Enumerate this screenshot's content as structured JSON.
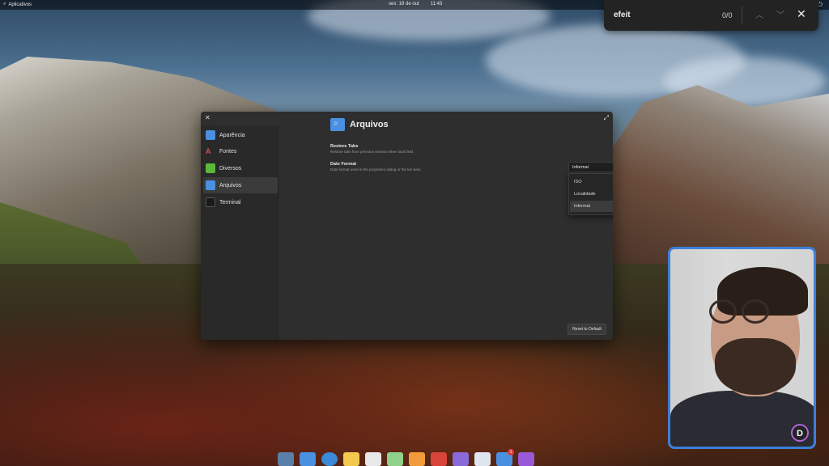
{
  "top_panel": {
    "apps_label": "Aplicativos",
    "date": "sex. 18 de out",
    "time": "11:43"
  },
  "search": {
    "query": "efeit",
    "count": "0/0"
  },
  "window": {
    "sidebar": [
      {
        "label": "Aparência",
        "icon": "appearance-icon"
      },
      {
        "label": "Fontes",
        "icon": "fonts-icon"
      },
      {
        "label": "Diversos",
        "icon": "puzzle-icon"
      },
      {
        "label": "Arquivos",
        "icon": "files-icon"
      },
      {
        "label": "Terminal",
        "icon": "terminal-icon"
      }
    ],
    "title": "Arquivos",
    "restore_tabs": {
      "title": "Restore Tabs",
      "description": "Restore tabs from previous session when launched."
    },
    "date_format": {
      "title": "Date Format",
      "description": "Date format used in the properties dialog or the list view.",
      "selected": "Informal",
      "options": [
        "ISO",
        "Localidade",
        "Informal"
      ]
    },
    "reset_label": "Reset to Default"
  },
  "webcam_logo": "D",
  "dock_badge": "1",
  "colors": {
    "accent": "#9b6ad6",
    "webcam_border": "#3d7fd9"
  }
}
